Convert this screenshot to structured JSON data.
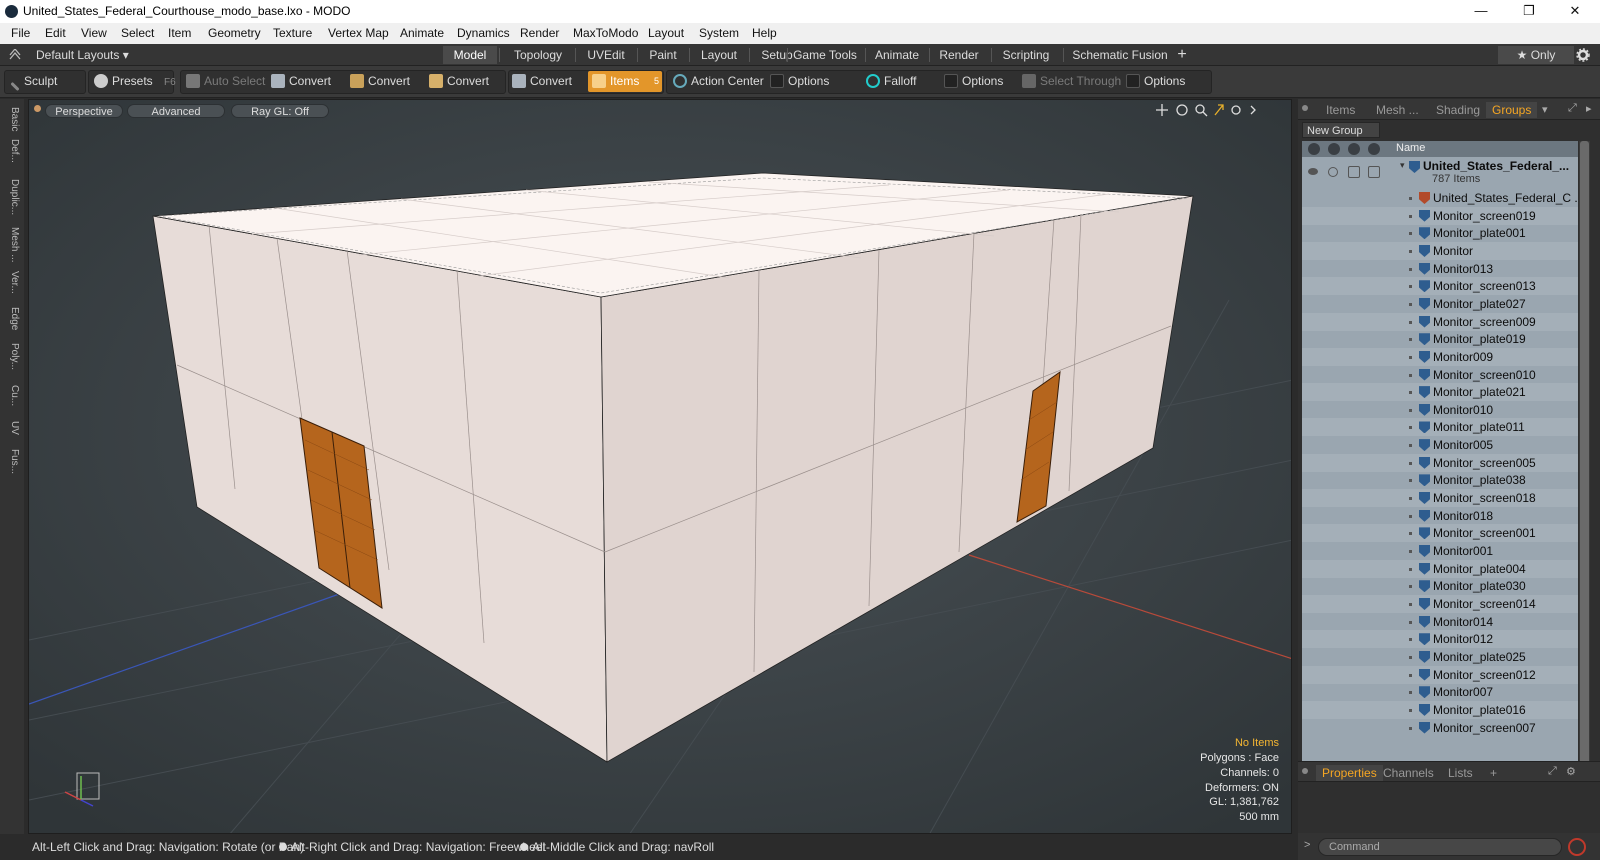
{
  "window": {
    "title": "United_States_Federal_Courthouse_modo_base.lxo - MODO",
    "minimize": "—",
    "maximize": "❐",
    "close": "✕"
  },
  "menu": [
    "File",
    "Edit",
    "View",
    "Select",
    "Item",
    "Geometry",
    "Texture",
    "Vertex Map",
    "Animate",
    "Dynamics",
    "Render",
    "MaxToModo",
    "Layout",
    "System",
    "Help"
  ],
  "layoutbar": {
    "layouts_label": "Default Layouts ▾",
    "tabs": [
      "Model",
      "Topology",
      "UVEdit",
      "Paint",
      "Layout",
      "Setup",
      "Game Tools",
      "Animate",
      "Render",
      "Scripting",
      "Schematic Fusion"
    ],
    "active_tab": "Model",
    "add": "+",
    "only_label": "★  Only"
  },
  "toolbar": {
    "sculpt": "Sculpt",
    "presets": "Presets",
    "presets_key": "F6",
    "auto_select": "Auto Select",
    "convert1": "Convert",
    "convert2": "Convert",
    "convert3": "Convert",
    "convert4": "Convert",
    "items": "Items",
    "items_key": "5",
    "action_center": "Action Center",
    "options1": "Options",
    "falloff": "Falloff",
    "options2": "Options",
    "select_through": "Select Through",
    "options3": "Options"
  },
  "left_tabs": [
    "Basic",
    "Def...",
    "Duplic...",
    "Mesh ...",
    "Ver...",
    "Edge",
    "Poly...",
    "Cu...",
    "UV",
    "Fus..."
  ],
  "viewport": {
    "view_mode": "Perspective",
    "shading": "Advanced",
    "raygl": "Ray GL: Off",
    "info": {
      "items": "No Items",
      "polygons": "Polygons : Face",
      "channels": "Channels: 0",
      "deformers": "Deformers: ON",
      "gl": "GL: 1,381,762",
      "grid": "500 mm"
    }
  },
  "right_panel": {
    "tabs": [
      "Items",
      "Mesh ...",
      "Shading",
      "Groups"
    ],
    "active_tab": "Groups",
    "new_group": "New Group",
    "column_name": "Name",
    "root": {
      "label": "United_States_Federal_...",
      "count": "787 Items"
    },
    "rows": [
      "United_States_Federal_C ...",
      "Monitor_screen019",
      "Monitor_plate001",
      "Monitor",
      "Monitor013",
      "Monitor_screen013",
      "Monitor_plate027",
      "Monitor_screen009",
      "Monitor_plate019",
      "Monitor009",
      "Monitor_screen010",
      "Monitor_plate021",
      "Monitor010",
      "Monitor_plate011",
      "Monitor005",
      "Monitor_screen005",
      "Monitor_plate038",
      "Monitor_screen018",
      "Monitor018",
      "Monitor_screen001",
      "Monitor001",
      "Monitor_plate004",
      "Monitor_plate030",
      "Monitor_screen014",
      "Monitor014",
      "Monitor012",
      "Monitor_plate025",
      "Monitor_screen012",
      "Monitor007",
      "Monitor_plate016",
      "Monitor_screen007"
    ],
    "prop_tabs": [
      "Properties",
      "Channels",
      "Lists"
    ],
    "prop_active": "Properties",
    "prop_add": "+",
    "command_placeholder": "Command",
    "command_prompt": ">"
  },
  "status": {
    "hint1": "Alt-Left Click and Drag: Navigation: Rotate (or Pan)",
    "hint2": "Alt-Right Click and Drag: Navigation: Freewheel",
    "hint3": "Alt-Middle Click and Drag: navRoll"
  },
  "colors": {
    "accent": "#f5a623",
    "wall": "#e8ddd8",
    "roof": "#fdf6f3",
    "door": "#b5651d"
  }
}
